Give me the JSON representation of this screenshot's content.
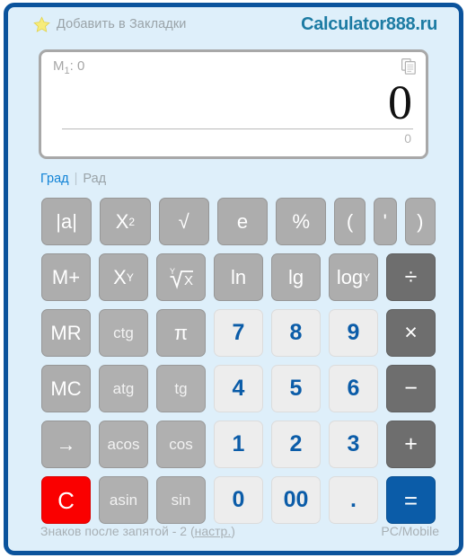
{
  "window": {
    "border_color": "#0b539c",
    "background_color": "#deeffa"
  },
  "header": {
    "bookmark_label": "Добавить в Закладки",
    "star_icon": "star-icon",
    "logo": "Calculator888.ru",
    "logo_color": "#1c7ba3"
  },
  "display": {
    "memory_prefix": "M",
    "memory_index": "1",
    "memory_text": ": 0",
    "copy_icon": "copy-icon",
    "result": "0",
    "sub_result": "0"
  },
  "modes": {
    "active": "Град",
    "separator": "|",
    "inactive": "Рад"
  },
  "keypad": {
    "rows": [
      [
        {
          "label": "|a|",
          "name": "key-abs",
          "style": "k-fn"
        },
        {
          "label": "X",
          "sup": "2",
          "name": "key-square",
          "style": "k-fn"
        },
        {
          "label": "√",
          "name": "key-sqrt",
          "style": "k-fn"
        },
        {
          "label": "e",
          "name": "key-e",
          "style": "k-fn"
        },
        {
          "label": "%",
          "name": "key-percent",
          "style": "k-fn"
        },
        {
          "label": "(",
          "name": "key-paren-open",
          "style": "k-fn",
          "width": "paren"
        },
        {
          "label": "'",
          "name": "key-apostrophe",
          "style": "k-fn",
          "width": "narrow"
        },
        {
          "label": ")",
          "name": "key-paren-close",
          "style": "k-fn",
          "width": "paren"
        }
      ],
      [
        {
          "label": "M+",
          "name": "key-memory-plus",
          "style": "k-fn"
        },
        {
          "label": "X",
          "sup": "Y",
          "name": "key-power",
          "style": "k-fn"
        },
        {
          "label": "ʸ√X",
          "name": "key-nth-root",
          "style": "k-fn",
          "icon": "radical"
        },
        {
          "label": "ln",
          "name": "key-ln",
          "style": "k-fn"
        },
        {
          "label": "lg",
          "name": "key-lg",
          "style": "k-fn"
        },
        {
          "label": "log",
          "sub": "Y",
          "name": "key-log-y",
          "style": "k-fn"
        },
        {
          "label": "÷",
          "name": "key-divide",
          "style": "k-op"
        }
      ],
      [
        {
          "label": "MR",
          "name": "key-memory-read",
          "style": "k-fn"
        },
        {
          "label": "ctg",
          "name": "key-ctg",
          "style": "k-fn-dim"
        },
        {
          "label": "π",
          "name": "key-pi",
          "style": "k-fn"
        },
        {
          "label": "7",
          "name": "key-7",
          "style": "k-num"
        },
        {
          "label": "8",
          "name": "key-8",
          "style": "k-num"
        },
        {
          "label": "9",
          "name": "key-9",
          "style": "k-num"
        },
        {
          "label": "×",
          "name": "key-multiply",
          "style": "k-op"
        }
      ],
      [
        {
          "label": "MC",
          "name": "key-memory-clear",
          "style": "k-fn"
        },
        {
          "label": "atg",
          "name": "key-atg",
          "style": "k-fn-dim"
        },
        {
          "label": "tg",
          "name": "key-tg",
          "style": "k-fn-dim"
        },
        {
          "label": "4",
          "name": "key-4",
          "style": "k-num"
        },
        {
          "label": "5",
          "name": "key-5",
          "style": "k-num"
        },
        {
          "label": "6",
          "name": "key-6",
          "style": "k-num"
        },
        {
          "label": "−",
          "name": "key-subtract",
          "style": "k-op"
        }
      ],
      [
        {
          "label": "→",
          "name": "key-backspace",
          "style": "k-fn"
        },
        {
          "label": "acos",
          "name": "key-acos",
          "style": "k-fn-dim"
        },
        {
          "label": "cos",
          "name": "key-cos",
          "style": "k-fn-dim"
        },
        {
          "label": "1",
          "name": "key-1",
          "style": "k-num"
        },
        {
          "label": "2",
          "name": "key-2",
          "style": "k-num"
        },
        {
          "label": "3",
          "name": "key-3",
          "style": "k-num"
        },
        {
          "label": "+",
          "name": "key-add",
          "style": "k-op"
        }
      ],
      [
        {
          "label": "C",
          "name": "key-clear",
          "style": "k-clear"
        },
        {
          "label": "asin",
          "name": "key-asin",
          "style": "k-fn-dim"
        },
        {
          "label": "sin",
          "name": "key-sin",
          "style": "k-fn-dim"
        },
        {
          "label": "0",
          "name": "key-0",
          "style": "k-num"
        },
        {
          "label": "00",
          "name": "key-double-zero",
          "style": "k-num"
        },
        {
          "label": ".",
          "name": "key-decimal",
          "style": "k-num"
        },
        {
          "label": "=",
          "name": "key-equals",
          "style": "k-eq"
        }
      ]
    ]
  },
  "footer": {
    "decimals_text": "Знаков после запятой - 2",
    "settings_open": "(",
    "settings_label": "настр.",
    "settings_close": ")",
    "pc_mobile": "PC/Mobile"
  }
}
